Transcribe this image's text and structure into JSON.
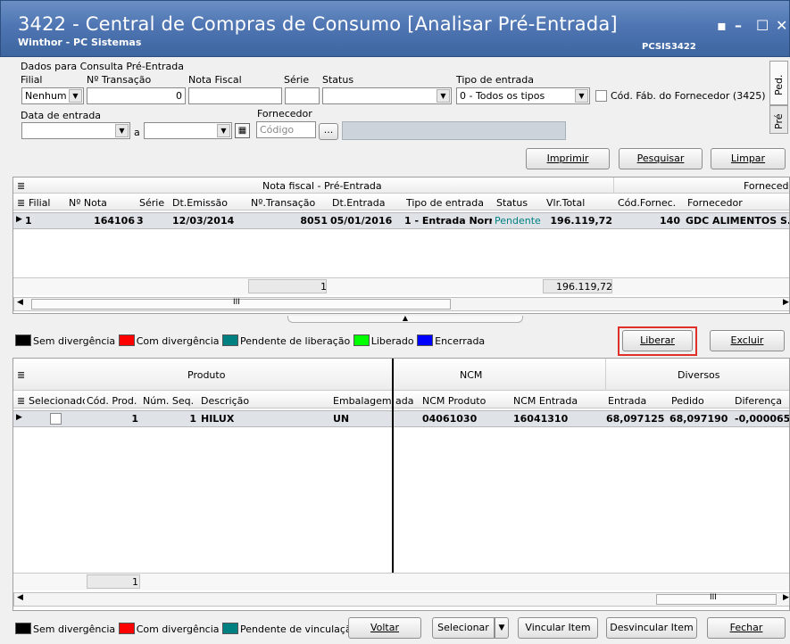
{
  "window": {
    "title": "3422 - Central de Compras de Consumo [Analisar Pré-Entrada]",
    "subtitle": "Winthor - PC Sistemas",
    "code": "PCSIS3422",
    "controls": [
      "▪",
      "–",
      "☐",
      "✕"
    ]
  },
  "filters": {
    "group_title": "Dados para Consulta Pré-Entrada",
    "filial_label": "Filial",
    "filial_value": "Nenhum",
    "transacao_label": "Nº Transação",
    "transacao_value": "0",
    "nota_label": "Nota Fiscal",
    "serie_label": "Série",
    "status_label": "Status",
    "tipo_label": "Tipo de entrada",
    "tipo_value": "0 - Todos os tipos",
    "cod_fab_label": "Cód. Fáb. do Fornecedor (3425)",
    "data_label": "Data de entrada",
    "a_label": "a",
    "fornecedor_label": "Fornecedor",
    "fornecedor_placeholder": "Código",
    "ellipsis": "...",
    "side_tabs": [
      "Ped.",
      "Pré"
    ]
  },
  "toolbar": {
    "imprimir": "Imprimir",
    "pesquisar": "Pesquisar",
    "limpar": "Limpar"
  },
  "top_grid": {
    "group_header": "Nota fiscal - Pré-Entrada",
    "group_header_right": "Forneced",
    "columns": [
      "Filial",
      "Nº Nota",
      "Série",
      "Dt.Emissão",
      "Nº.Transação",
      "Dt.Entrada",
      "Tipo de entrada",
      "Status",
      "Vlr.Total",
      "Cód.Fornec.",
      "Fornecedor"
    ],
    "row": [
      "1",
      "164106",
      "3",
      "12/03/2014",
      "8051",
      "05/01/2016",
      "1 - Entrada Norr",
      "Pendente",
      "196.119,72",
      "140",
      "GDC ALIMENTOS S."
    ],
    "footer_count": "1",
    "footer_total": "196.119,72",
    "scroll_mark": "III"
  },
  "legend_top": {
    "items": [
      {
        "label": "Sem divergência",
        "color": "#000000"
      },
      {
        "label": "Com divergência",
        "color": "#ff0000"
      },
      {
        "label": "Pendente de liberação",
        "color": "#008080"
      },
      {
        "label": "Liberado",
        "color": "#00ff00"
      },
      {
        "label": "Encerrada",
        "color": "#0000ff"
      }
    ]
  },
  "actions": {
    "liberar": "Liberar",
    "excluir": "Excluir"
  },
  "bottom_grid": {
    "groups": [
      "Produto",
      "NCM",
      "Diversos"
    ],
    "columns": [
      "Selecionado",
      "Cód. Prod.",
      "Núm. Seq.",
      "Descrição",
      "Embalagem",
      "ada",
      "NCM Produto",
      "NCM Entrada",
      "Entrada",
      "Pedido",
      "Diferença"
    ],
    "row": [
      "1",
      "1",
      "HILUX",
      "UN",
      "04061030",
      "16041310",
      "68,097125",
      "68,097190",
      "-0,000065"
    ],
    "footer_count": "1",
    "scroll_mark": "III"
  },
  "legend_bottom": {
    "items": [
      {
        "label": "Sem divergência",
        "color": "#000000"
      },
      {
        "label": "Com divergência",
        "color": "#ff0000"
      },
      {
        "label": "Pendente de vinculação",
        "color": "#008080"
      }
    ]
  },
  "bottom_buttons": {
    "voltar": "Voltar",
    "selecionar": "Selecionar",
    "vincular": "Vincular Item",
    "desvincular": "Desvincular Item",
    "fechar": "Fechar"
  },
  "colors": {
    "title_bar": "#4f76b3",
    "highlight_border": "#e0302a",
    "selected_row": "#dfe3e8"
  }
}
